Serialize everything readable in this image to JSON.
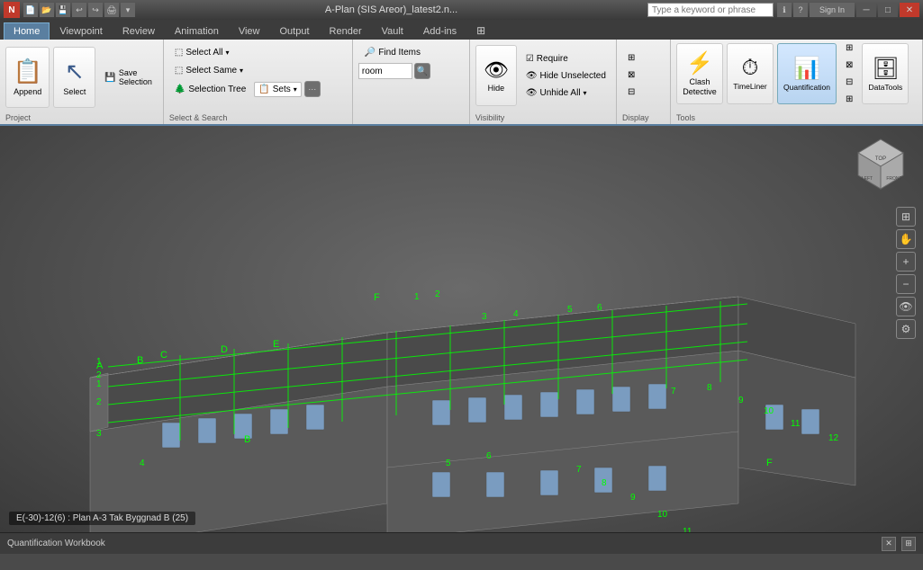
{
  "titlebar": {
    "logo": "N",
    "filename": "A-Plan (SIS Areor)_latest2.n...",
    "search_placeholder": "Type a keyword or phrase",
    "min_label": "─",
    "max_label": "□",
    "close_label": "✕"
  },
  "ribbon_tabs": [
    {
      "label": "Home",
      "active": true
    },
    {
      "label": "Viewpoint"
    },
    {
      "label": "Review"
    },
    {
      "label": "Animation"
    },
    {
      "label": "View"
    },
    {
      "label": "Output"
    },
    {
      "label": "Render"
    },
    {
      "label": "Vault"
    },
    {
      "label": "Add-ins"
    }
  ],
  "ribbon": {
    "project_group_label": "Project",
    "select_search_group_label": "Select & Search",
    "visibility_group_label": "Visibility",
    "display_group_label": "Display",
    "tools_group_label": "Tools",
    "append_label": "Append",
    "select_label": "Select",
    "save_selection_label": "Save\nSelection",
    "select_all_label": "Select All",
    "select_all_arrow": "▾",
    "select_same_label": "Select Same",
    "select_same_arrow": "▾",
    "selection_tree_label": "Selection Tree",
    "sets_label": "Sets",
    "sets_arrow": "▾",
    "find_items_label": "Find Items",
    "require_label": "Require",
    "hide_unselected_label": "Hide Unselected",
    "unhide_all_label": "Unhide All",
    "unhide_all_arrow": "▾",
    "hide_label": "Hide",
    "clash_detective_label": "Clash\nDetective",
    "timeliner_label": "TimeLiner",
    "quantification_label": "Quantification",
    "datatools_label": "DataTools",
    "room_input_value": "room",
    "search_icon": "🔍",
    "append_icon": "📋",
    "select_icon": "↖",
    "select_all_icon": "⬜",
    "select_same_icon": "⬜",
    "selection_tree_icon": "🌲",
    "find_items_icon": "🔎",
    "require_icon": "☑",
    "hide_unselected_icon": "👁",
    "unhide_all_icon": "👁",
    "hide_icon": "👁",
    "clash_icon": "⚡",
    "timeliner_icon": "⏱",
    "quantification_icon": "📊",
    "datatools_icon": "🗄"
  },
  "viewport": {
    "status_text": "E(-30)-12(6) : Plan A-3 Tak Byggnad B (25)"
  },
  "workbook": {
    "label": "Quantification Workbook"
  }
}
